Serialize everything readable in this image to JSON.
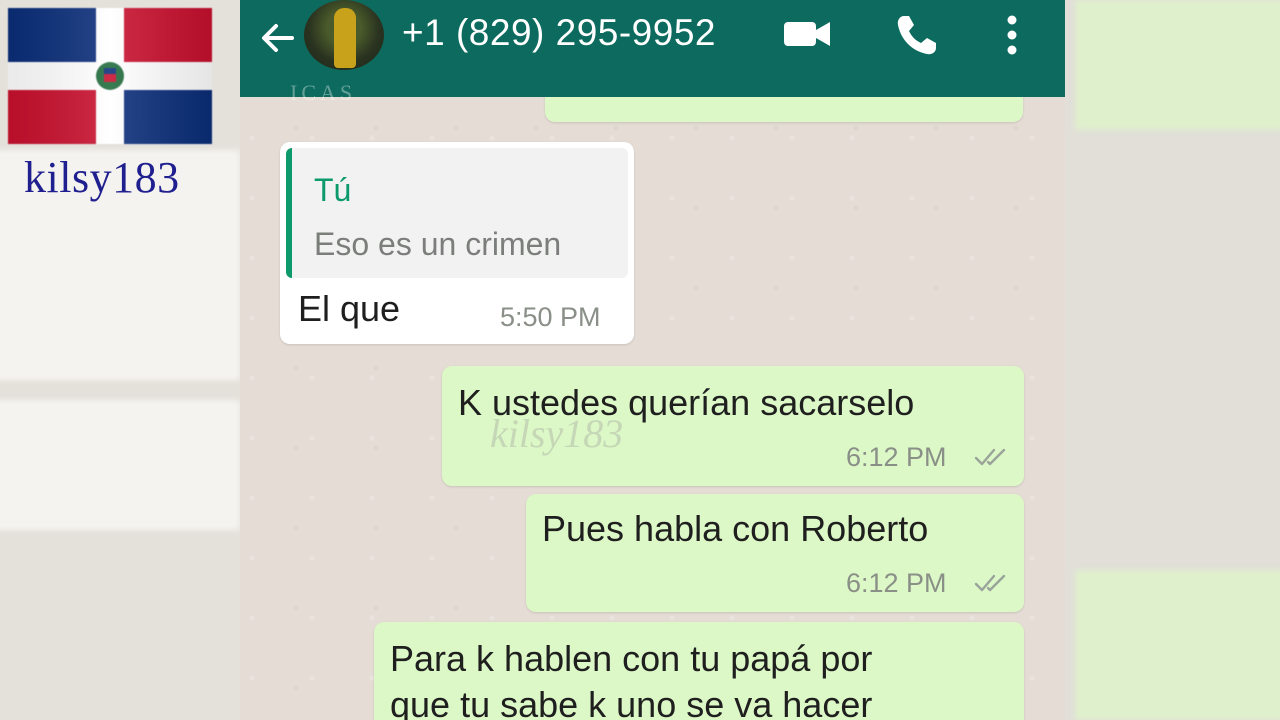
{
  "uploader": {
    "name": "kilsy183"
  },
  "header": {
    "contact": "+1 (829) 295-9952",
    "faded_banner": "ICAS"
  },
  "messages": [
    {
      "direction": "incoming",
      "quote_author": "Tú",
      "quote_text": "Eso es un crimen",
      "text": "El que",
      "time": "5:50 PM"
    },
    {
      "direction": "outgoing",
      "text": "K ustedes querían sacarselo",
      "time": "6:12 PM",
      "status": "read"
    },
    {
      "direction": "outgoing",
      "text": "Pues habla con Roberto",
      "time": "6:12 PM",
      "status": "read"
    },
    {
      "direction": "outgoing",
      "lines": [
        "Para k hablen con tu papá por",
        "que tu sabe k uno se va hacer"
      ]
    }
  ],
  "watermark": "kilsy183",
  "colors": {
    "appbar": "#0c6b5e",
    "outgoing_bubble": "#dcf8c6",
    "incoming_bubble": "#ffffff",
    "chat_background": "#e5ddd5",
    "quote_accent": "#0c9a6c"
  },
  "icons": [
    "back-arrow-icon",
    "video-call-icon",
    "phone-call-icon",
    "more-vert-icon",
    "double-check-icon"
  ]
}
